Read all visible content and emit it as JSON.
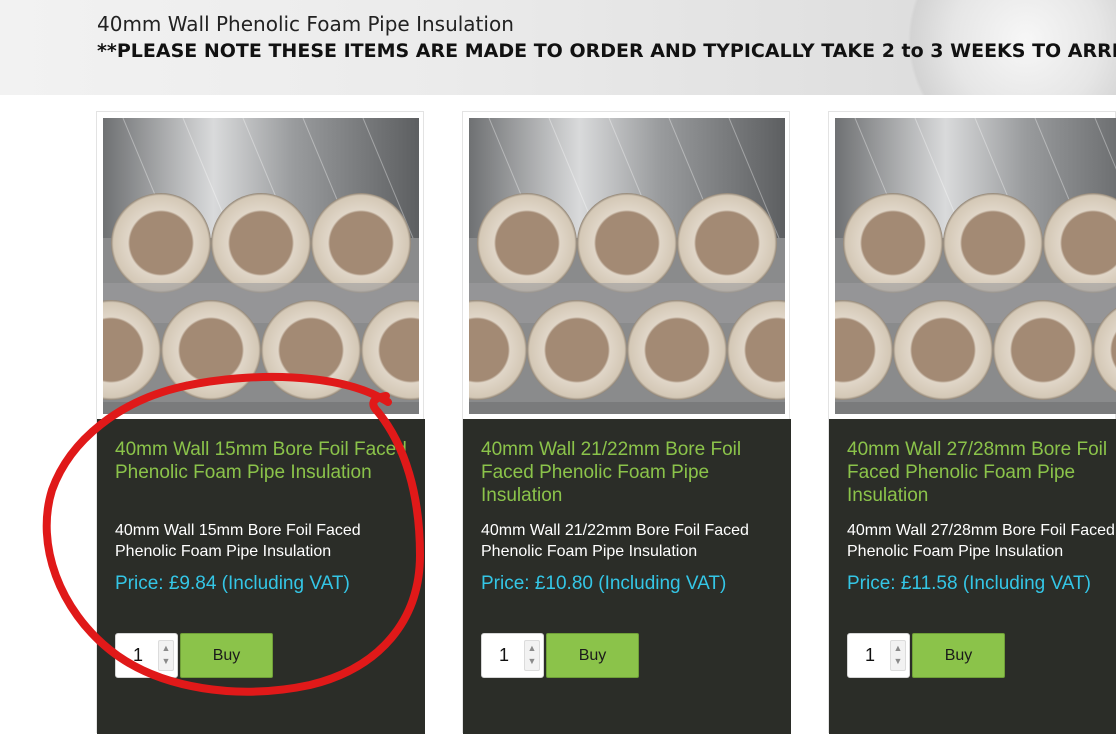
{
  "banner": {
    "title": "40mm Wall Phenolic Foam Pipe Insulation",
    "note": "**PLEASE NOTE THESE ITEMS ARE MADE TO ORDER AND TYPICALLY TAKE 2 to 3 WEEKS TO ARRIVE**"
  },
  "products": [
    {
      "title": "40mm Wall 15mm Bore Foil Faced Phenolic Foam Pipe Insulation",
      "description": "40mm Wall 15mm Bore Foil Faced Phenolic Foam Pipe Insulation",
      "price": "Price: £9.84 (Including VAT)",
      "quantity": "1",
      "buy_label": "Buy"
    },
    {
      "title": "40mm Wall 21/22mm Bore Foil Faced Phenolic Foam Pipe Insulation",
      "description": "40mm Wall 21/22mm Bore Foil Faced Phenolic Foam Pipe Insulation",
      "price": "Price: £10.80 (Including VAT)",
      "quantity": "1",
      "buy_label": "Buy"
    },
    {
      "title": "40mm Wall 27/28mm Bore Foil Faced Phenolic Foam Pipe Insulation",
      "description": "40mm Wall 27/28mm Bore Foil Faced Phenolic Foam Pipe Insulation",
      "price": "Price: £11.58 (Including VAT)",
      "quantity": "1",
      "buy_label": "Buy"
    }
  ],
  "colors": {
    "title_green": "#8bc34a",
    "price_cyan": "#34c6e6",
    "card_dark": "#2b2d28",
    "annotation_red": "#e01919"
  },
  "icons": {
    "spinner_up": "chevron-up-icon",
    "spinner_down": "chevron-down-icon"
  }
}
